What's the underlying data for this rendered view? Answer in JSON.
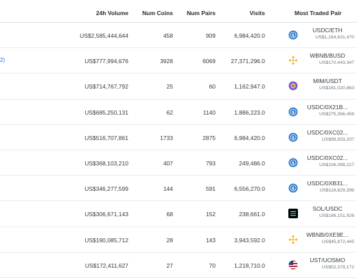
{
  "columns": {
    "volume": "24h Volume",
    "coins": "Num Coins",
    "pairs": "Num Pairs",
    "visits": "Visits",
    "pair": "Most Traded Pair"
  },
  "rows": [
    {
      "fragment": "",
      "volume": "US$2,585,444,644",
      "coins": "458",
      "pairs": "909",
      "visits": "6,984,420.0",
      "pair": "USDC/ETH",
      "pair_volume": "US$1,164,631,470",
      "icon": "usdc-icon"
    },
    {
      "fragment": "2)",
      "volume": "US$777,994,676",
      "coins": "3928",
      "pairs": "6069",
      "visits": "27,371,296.0",
      "pair": "WBNB/BUSD",
      "pair_volume": "US$170,443,347",
      "icon": "bnb-icon"
    },
    {
      "fragment": "",
      "volume": "US$714,767,792",
      "coins": "25",
      "pairs": "60",
      "visits": "1,162,947.0",
      "pair": "MIM/USDT",
      "pair_volume": "US$161,020,863",
      "icon": "mim-icon"
    },
    {
      "fragment": "",
      "volume": "US$685,250,131",
      "coins": "62",
      "pairs": "1140",
      "visits": "1,886,223.0",
      "pair": "USDC/0X21B...",
      "pair_volume": "US$275,356,456",
      "icon": "usdc-icon"
    },
    {
      "fragment": "",
      "volume": "US$516,707,861",
      "coins": "1733",
      "pairs": "2875",
      "visits": "6,984,420.0",
      "pair": "USDC/0XC02...",
      "pair_volume": "US$98,933,207",
      "icon": "usdc-icon"
    },
    {
      "fragment": "",
      "volume": "US$368,103,210",
      "coins": "407",
      "pairs": "793",
      "visits": "249,486.0",
      "pair": "USDC/0XC02...",
      "pair_volume": "US$106,089,227",
      "icon": "usdc-icon"
    },
    {
      "fragment": "",
      "volume": "US$346,277,599",
      "coins": "144",
      "pairs": "591",
      "visits": "6,556,270.0",
      "pair": "USDC/0XB31...",
      "pair_volume": "US$116,829,399",
      "icon": "usdc-icon"
    },
    {
      "fragment": "",
      "volume": "US$306,671,143",
      "coins": "68",
      "pairs": "152",
      "visits": "238,661.0",
      "pair": "SOL/USDC",
      "pair_volume": "US$186,151,926",
      "icon": "sol-icon"
    },
    {
      "fragment": "",
      "volume": "US$190,085,712",
      "coins": "28",
      "pairs": "143",
      "visits": "3,943,592.0",
      "pair": "WBNB/0XE9E...",
      "pair_volume": "US$45,872,445",
      "icon": "bnb-icon"
    },
    {
      "fragment": "",
      "volume": "US$172,411,627",
      "coins": "27",
      "pairs": "70",
      "visits": "1,218,710.0",
      "pair": "UST/UOSMO",
      "pair_volume": "US$52,378,172",
      "icon": "flag-icon"
    }
  ],
  "colors": {
    "usdc": "#2775ca",
    "bnb": "#f3ba2f",
    "mim": "#7b5cd6",
    "sol": "#000000",
    "link": "#0d6efd"
  }
}
